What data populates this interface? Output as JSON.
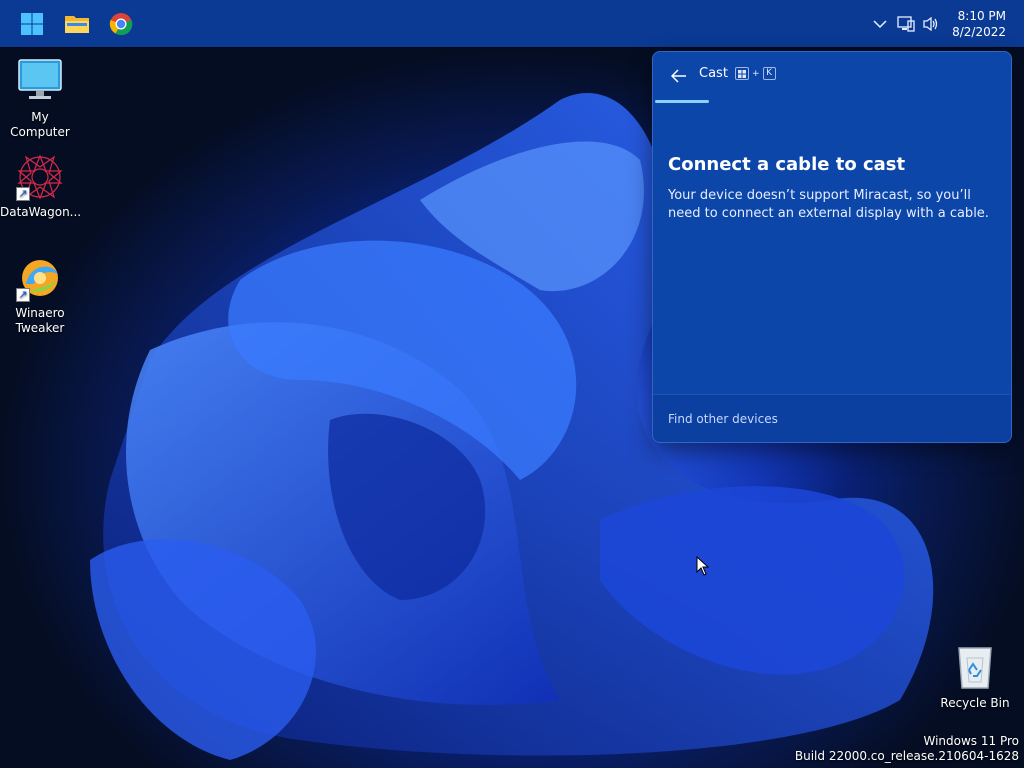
{
  "taskbar": {
    "clock": {
      "time": "8:10 PM",
      "date": "8/2/2022"
    }
  },
  "desktop": {
    "icons": [
      {
        "label": "My Computer"
      },
      {
        "label": "DataWagon..."
      },
      {
        "label": "Winaero\nTweaker"
      },
      {
        "label": "Recycle Bin"
      }
    ]
  },
  "cast": {
    "title": "Cast",
    "shortcut_key": "K",
    "shortcut_plus": "+",
    "heading": "Connect a cable to cast",
    "body": "Your device doesn’t support Miracast, so you’ll need to connect an external display with a cable.",
    "footer_link": "Find other devices"
  },
  "watermark": {
    "edition": "Windows 11 Pro",
    "build": "Build 22000.co_release.210604-1628"
  },
  "colors": {
    "taskbar": "#0a3a93",
    "flyout": "#0d46a9",
    "accent": "#8ad0ff"
  }
}
